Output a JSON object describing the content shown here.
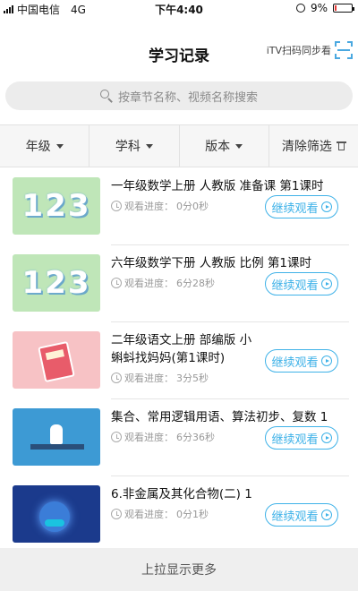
{
  "status_bar": {
    "carrier": "中国电信",
    "network": "4G",
    "time": "下午4:40",
    "battery": "9%",
    "battery_level": 0.09,
    "colors": {
      "battery_low": "#e53935"
    }
  },
  "header": {
    "title": "学习记录",
    "scan_label": "iTV扫码同步看",
    "scan_icon": "scan-icon"
  },
  "search": {
    "placeholder": "按章节名称、视频名称搜索",
    "icon": "search-icon"
  },
  "filters": [
    {
      "label": "年级",
      "icon": "chevron-down-icon"
    },
    {
      "label": "学科",
      "icon": "chevron-down-icon"
    },
    {
      "label": "版本",
      "icon": "chevron-down-icon"
    },
    {
      "label": "清除筛选",
      "icon": "trash-icon"
    }
  ],
  "courses": [
    {
      "title": "一年级数学上册 人教版 准备课 第1课时",
      "progress_label": "观看进度：",
      "progress": "0分0秒",
      "button": "继续观看",
      "thumbnail": "123-green"
    },
    {
      "title": "六年级数学下册 人教版 比例 第1课时",
      "progress_label": "观看进度：",
      "progress": "6分28秒",
      "button": "继续观看",
      "thumbnail": "123-green"
    },
    {
      "title": "二年级语文上册 部编版 小蝌蚪找妈妈(第1课时)",
      "progress_label": "观看进度：",
      "progress": "3分5秒",
      "button": "继续观看",
      "thumbnail": "book-pink"
    },
    {
      "title": "集合、常用逻辑用语、算法初步、复数 1",
      "progress_label": "观看进度：",
      "progress": "6分36秒",
      "button": "继续观看",
      "thumbnail": "teacher-blue"
    },
    {
      "title": "6.非金属及其化合物(二) 1",
      "progress_label": "观看进度：",
      "progress": "0分1秒",
      "button": "继续观看",
      "thumbnail": "planet-navy"
    }
  ],
  "load_more": "上拉显示更多",
  "colors": {
    "accent": "#3fb2e8",
    "filter_bg": "#f6f6f6",
    "search_bg": "#ececec"
  }
}
